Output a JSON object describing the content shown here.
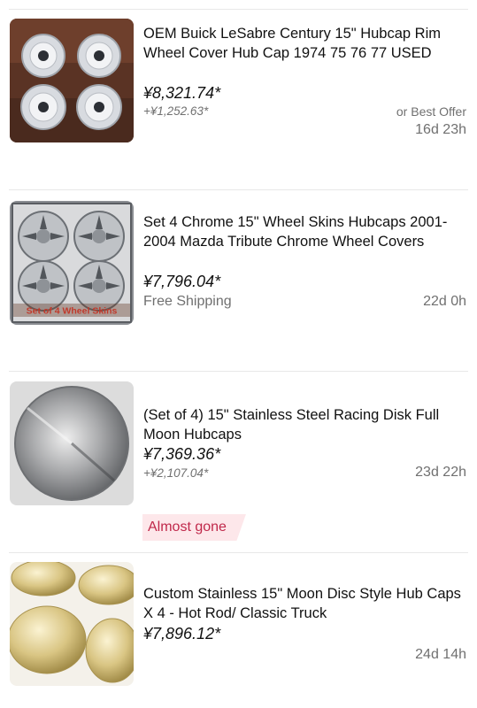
{
  "listings": [
    {
      "title": "OEM Buick LeSabre Century 15\" Hubcap Rim Wheel Cover Hub Cap 1974 75 76 77 USED",
      "price": "¥8,321.74*",
      "shipping": "+¥1,252.63*",
      "offer": "or Best Offer",
      "time_left": "16d 23h"
    },
    {
      "title": "Set 4 Chrome 15\" Wheel Skins Hubcaps 2001-2004 Mazda Tribute Chrome Wheel Covers",
      "price": "¥7,796.04*",
      "shipping": "Free Shipping",
      "time_left": "22d 0h",
      "image_caption": "Set of 4 Wheel Skins"
    },
    {
      "title": "(Set of 4) 15\" Stainless Steel Racing Disk Full Moon Hubcaps",
      "price": "¥7,369.36*",
      "shipping": "+¥2,107.04*",
      "time_left": "23d 22h",
      "badge": "Almost gone"
    },
    {
      "title": "Custom Stainless 15\" Moon Disc Style Hub Caps X 4 - Hot Rod/ Classic Truck",
      "price": "¥7,896.12*",
      "time_left": "24d 14h"
    }
  ]
}
